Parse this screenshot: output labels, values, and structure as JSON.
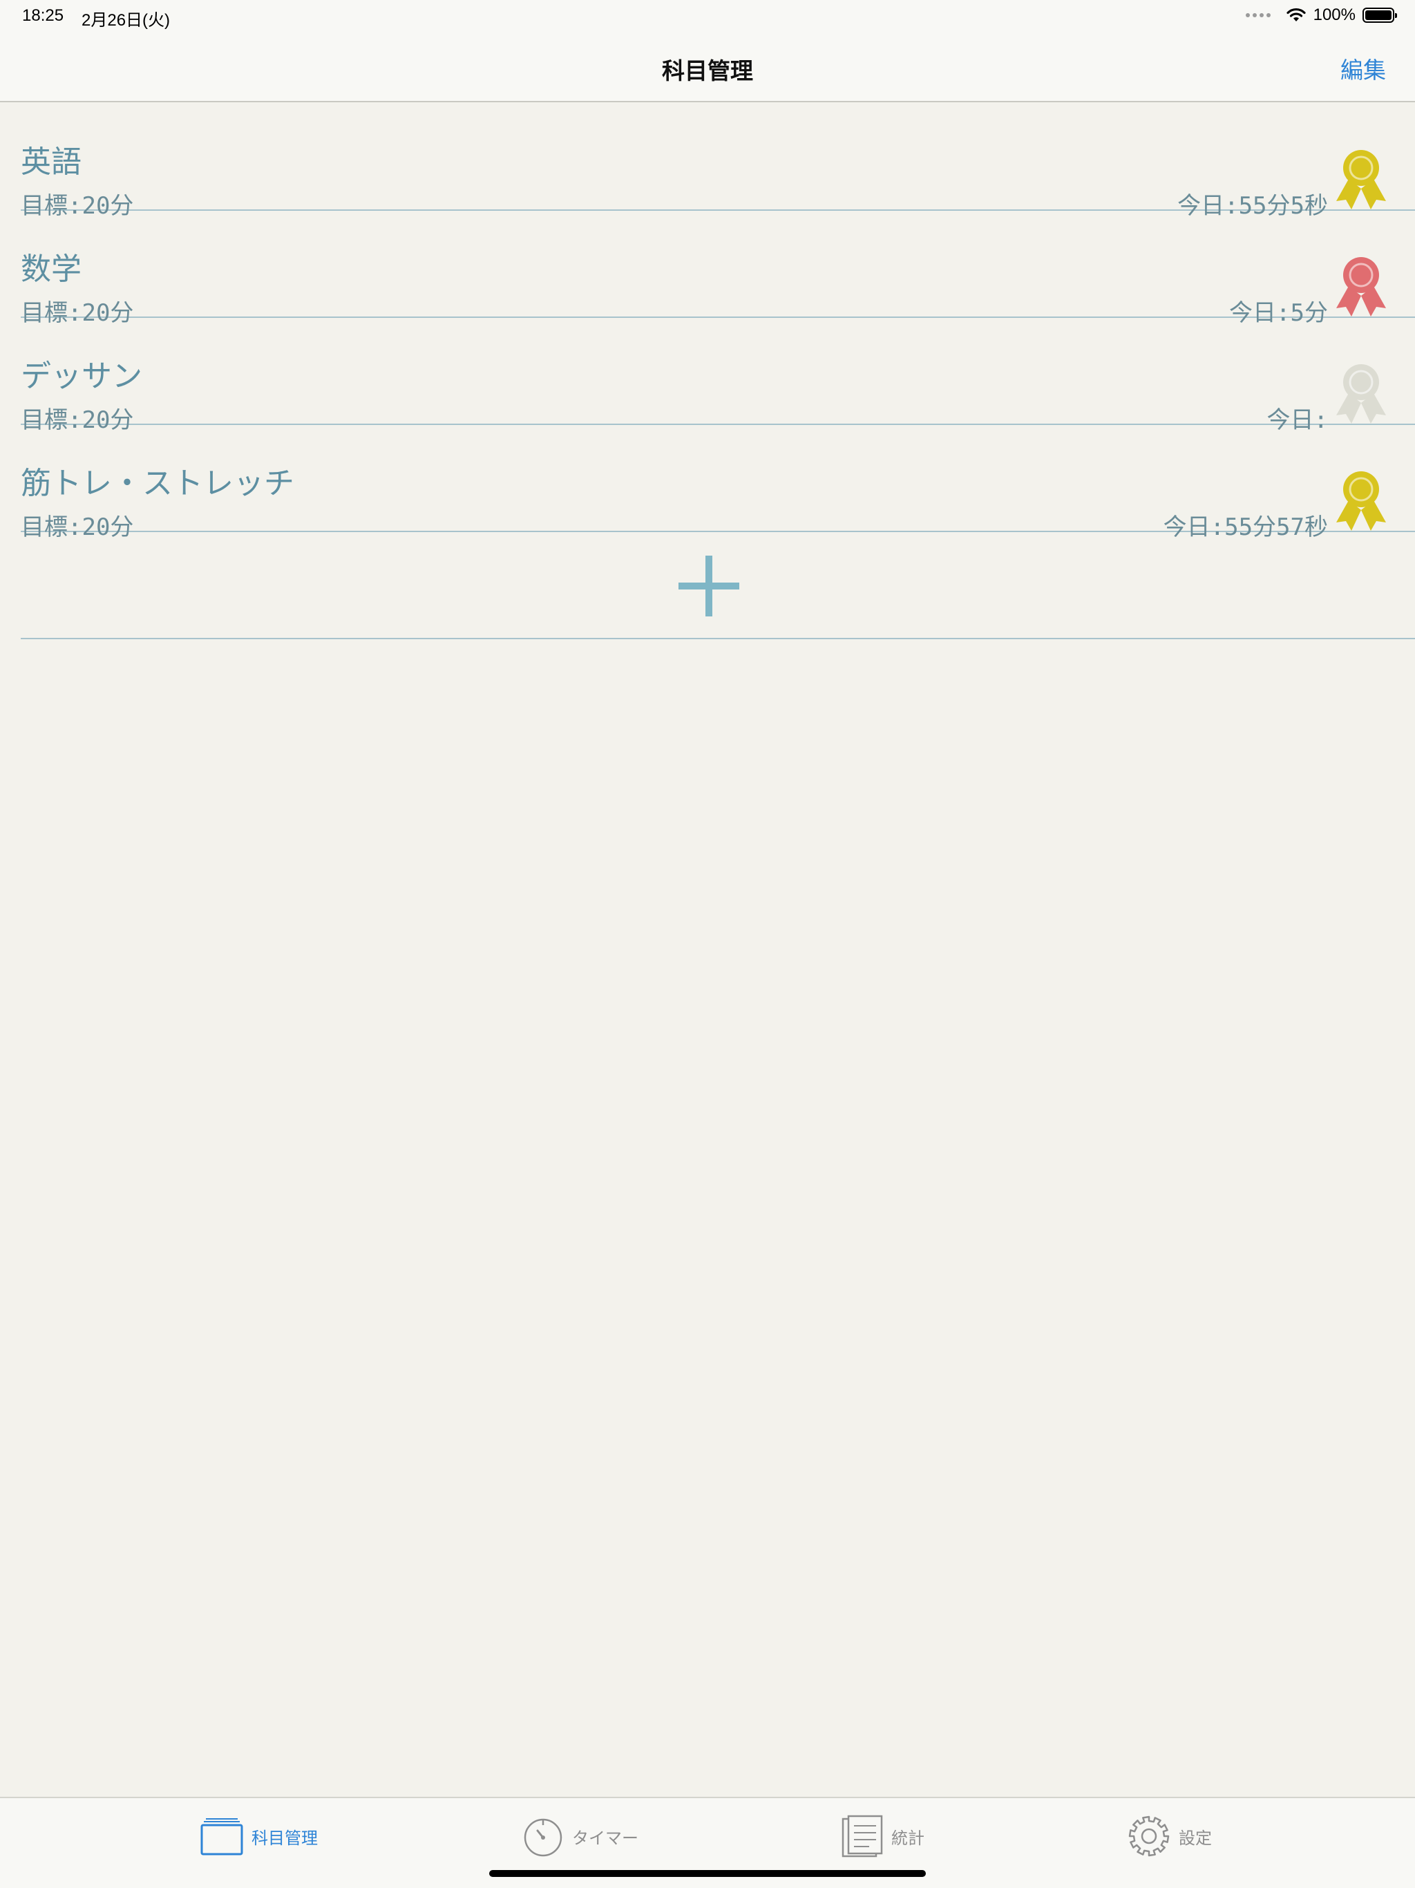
{
  "status_bar": {
    "time": "18:25",
    "date": "2月26日(火)",
    "battery": "100%"
  },
  "nav": {
    "title": "科目管理",
    "edit_label": "編集"
  },
  "subjects": [
    {
      "name": "英語",
      "goal": "目標:20分",
      "today": "今日:55分5秒",
      "medal_color": "#d8c41e",
      "medal_icon": "award-ribbon-icon"
    },
    {
      "name": "数学",
      "goal": "目標:20分",
      "today": "今日:5分",
      "medal_color": "#e06d70",
      "medal_icon": "award-ribbon-icon"
    },
    {
      "name": "デッサン",
      "goal": "目標:20分",
      "today": "今日:",
      "medal_color": "#dcdcd2",
      "medal_icon": "award-ribbon-icon"
    },
    {
      "name": "筋トレ・ストレッチ",
      "goal": "目標:20分",
      "today": "今日:55分57秒",
      "medal_color": "#d8c41e",
      "medal_icon": "award-ribbon-icon"
    }
  ],
  "add_button": {
    "icon": "plus-icon",
    "color": "#7fb6c6"
  },
  "tabs": [
    {
      "label": "科目管理",
      "icon": "folder-stack-icon",
      "active": true
    },
    {
      "label": "タイマー",
      "icon": "stopwatch-icon",
      "active": false
    },
    {
      "label": "統計",
      "icon": "document-list-icon",
      "active": false
    },
    {
      "label": "設定",
      "icon": "gear-icon",
      "active": false
    }
  ],
  "colors": {
    "accent": "#2e84d6",
    "text_teal": "#5d8fa2",
    "divider": "#a7c3cc",
    "background": "#f3f2ec"
  }
}
